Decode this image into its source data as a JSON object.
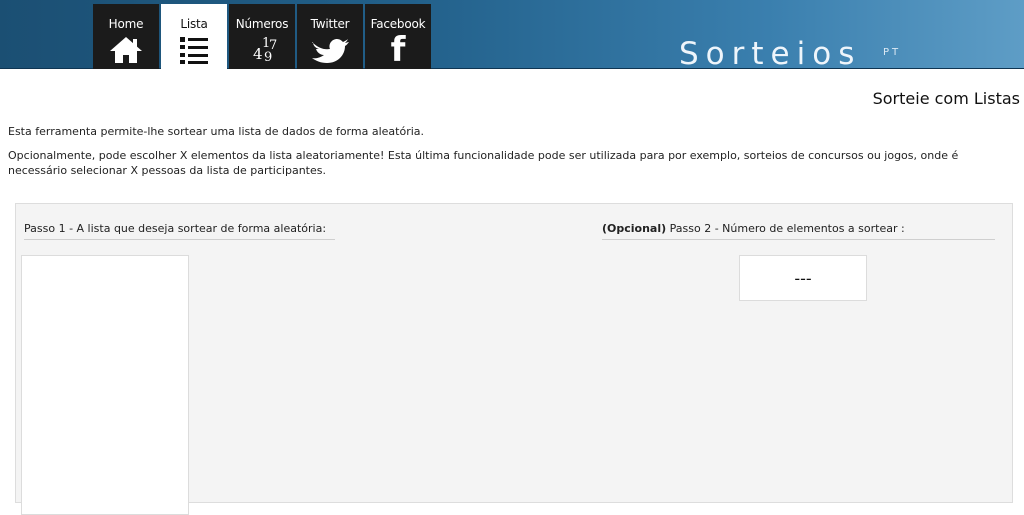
{
  "nav": {
    "tabs": [
      {
        "label": "Home",
        "icon": "home-icon"
      },
      {
        "label": "Lista",
        "icon": "list-icon",
        "active": true
      },
      {
        "label": "Números",
        "icon": "numbers-icon"
      },
      {
        "label": "Twitter",
        "icon": "twitter-bird-icon"
      },
      {
        "label": "Facebook",
        "icon": "facebook-f-icon"
      }
    ],
    "numbers_glyph": {
      "a": "4",
      "b": "1",
      "c": "7",
      "d": "9"
    },
    "facebook_glyph": "f"
  },
  "brand": {
    "name": "Sorteios",
    "suffix": "PT"
  },
  "page": {
    "title": "Sorteie com Listas",
    "intro_1": "Esta ferramenta permite-lhe sortear uma lista de dados de forma aleatória.",
    "intro_2": "Opcionalmente, pode escolher X elementos da lista aleatoriamente! Esta última funcionalidade pode ser utilizada para por exemplo, sorteios de concursos ou jogos, onde é necessário selecionar X pessoas da lista de participantes."
  },
  "form": {
    "step1_label": "Passo 1 - A lista que deseja sortear de forma aleatória:",
    "step2_optional": "(Opcional)",
    "step2_label": " Passo 2 - Número de elementos a sortear :",
    "count_value": "---"
  },
  "colors": {
    "header_dark": "#1b4f73",
    "header_light": "#5e9dc6",
    "tab_bg": "#1b1b1b",
    "panel_bg": "#f4f4f4"
  }
}
